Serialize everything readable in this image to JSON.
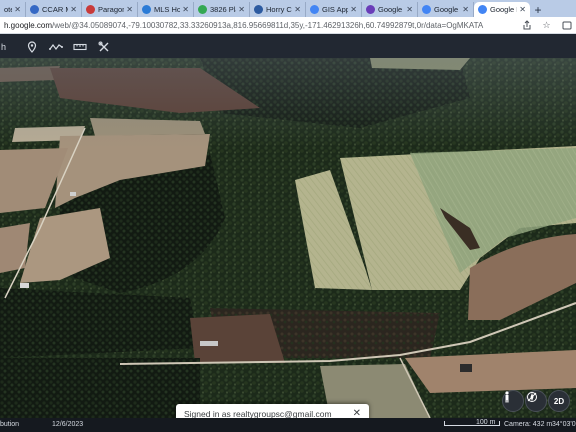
{
  "browser": {
    "first_tab": "otes",
    "tabs": [
      {
        "label": "CCAR Me",
        "favicon": "#3568c4"
      },
      {
        "label": "Paragon 5",
        "favicon": "#c83a3a"
      },
      {
        "label": "MLS Horr",
        "favicon": "#2b7bd6"
      },
      {
        "label": "3826 Plai",
        "favicon": "#34a853"
      },
      {
        "label": "Horry Co",
        "favicon": "#2c5aa0"
      },
      {
        "label": "GIS Appli",
        "favicon": "#4285f4"
      },
      {
        "label": "Google E",
        "favicon": "#6a3db8"
      },
      {
        "label": "Google E",
        "favicon": "#4285f4"
      },
      {
        "label": "Google E",
        "favicon": "#4285f4",
        "active": true
      }
    ],
    "new_tab": "+",
    "url_host": "h.google.com",
    "url_rest": "/web/@34.05089074,-79.10030782,33.33260913a,816.95669811d,35y,-171.46291326h,60.74992879t,0r/data=OgMKATA"
  },
  "toolbar": {
    "search_fragment": "h",
    "buttons": [
      "location-pin-icon",
      "path-icon",
      "ruler-icon",
      "tools-icon"
    ]
  },
  "map": {
    "popup_text": "Signed in as realtygroupsc@gmail.com",
    "popup_close": "✕",
    "view_2d": "2D"
  },
  "status": {
    "left_fragment": "bution",
    "date": "12/6/2023",
    "scale": "100 m",
    "camera": "Camera: 432 m",
    "coords": "34°03'0"
  }
}
